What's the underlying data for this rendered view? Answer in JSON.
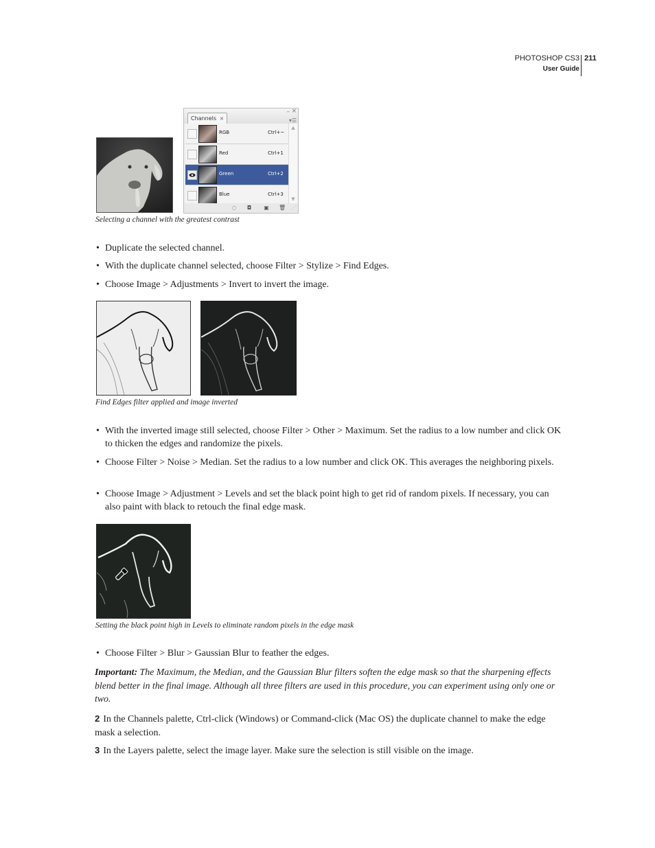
{
  "header": {
    "product": "PHOTOSHOP CS3",
    "guide": "User Guide",
    "page_number": "211"
  },
  "figure1": {
    "photo_alt": "grayscale goat photo",
    "caption": "Selecting a channel with the greatest contrast",
    "palette": {
      "tab_label": "Channels",
      "tab_close": "×",
      "minimize": "–",
      "close": "×",
      "menu_icon": "palette-menu-icon",
      "channels": [
        {
          "name": "RGB",
          "shortcut": "Ctrl+~",
          "visible": false,
          "selected": false
        },
        {
          "name": "Red",
          "shortcut": "Ctrl+1",
          "visible": false,
          "selected": false
        },
        {
          "name": "Green",
          "shortcut": "Ctrl+2",
          "visible": true,
          "selected": true
        },
        {
          "name": "Blue",
          "shortcut": "Ctrl+3",
          "visible": false,
          "selected": false
        }
      ],
      "footer_buttons": [
        "load-channel-as-selection",
        "save-selection-as-channel",
        "create-new-channel",
        "delete-channel"
      ],
      "selected_color": "#3d5b9c"
    }
  },
  "bullets1": [
    "Duplicate the selected channel.",
    "With the duplicate channel selected, choose Filter > Stylize > Find Edges.",
    "Choose Image > Adjustments > Invert to invert the image."
  ],
  "figure2": {
    "caption": "Find Edges filter applied and image inverted"
  },
  "bullets2": [
    "With the inverted image still selected, choose Filter > Other > Maximum. Set the radius to a low number and click OK to thicken the edges and randomize the pixels.",
    "Choose Filter > Noise > Median. Set the radius to a low number and click OK. This averages the neighboring pixels.",
    "Choose Image > Adjustment > Levels and set the black point high to get rid of random pixels. If necessary, you can also paint with black to retouch the final edge mask."
  ],
  "figure3": {
    "caption": "Setting the black point high in Levels to eliminate random pixels in the edge mask"
  },
  "bullets3": [
    "Choose Filter > Blur > Gaussian Blur to feather the edges."
  ],
  "important": {
    "label": "Important:",
    "text": " The Maximum, the Median, and the Gaussian Blur filters soften the edge mask so that the sharpening effects blend better in the final image. Although all three filters are used in this procedure, you can experiment using only one or two."
  },
  "steps": [
    {
      "number": "2",
      "text": "In the Channels palette, Ctrl-click (Windows) or Command-click (Mac OS) the duplicate channel to make the edge mask a selection."
    },
    {
      "number": "3",
      "text": "In the Layers palette, select the image layer. Make sure the selection is still visible on the image."
    }
  ],
  "bullet_glyph": "•"
}
